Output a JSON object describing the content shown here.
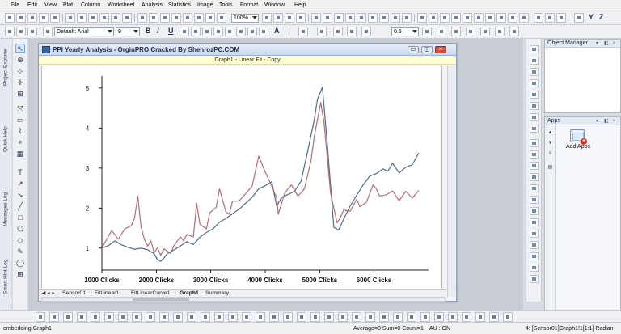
{
  "menubar": {
    "items": [
      "File",
      "Edit",
      "View",
      "Plot",
      "Column",
      "Worksheet",
      "Analysis",
      "Statistics",
      "Image",
      "Tools",
      "Format",
      "Window",
      "Help"
    ]
  },
  "toolbar": {
    "zoom": "100%",
    "font_name": "Default: Arial",
    "font_size": "9",
    "line_width": "0.5"
  },
  "left_dock": {
    "tabs": [
      "Project Explorer",
      "Quick Help",
      "Messages Log",
      "Smart Hint Log"
    ]
  },
  "graph_window": {
    "title": "PPI Yearly Analysis - OrginPRO Cracked By ShehrozPC.COM",
    "subtitle": "Graph1 - Linear Fit - Copy",
    "controls": {
      "minimize": "▭",
      "restore": "◫",
      "close": "×"
    }
  },
  "chart_data": {
    "type": "line",
    "title": "",
    "xlabel": "",
    "ylabel": "",
    "xlim": [
      0,
      100
    ],
    "ylim": [
      0.45,
      5.3
    ],
    "grid": false,
    "x_ticks": [
      {
        "label": "1000 Clicks",
        "value": 0
      },
      {
        "label": "2000 Clicks",
        "value": 16.7
      },
      {
        "label": "3000 Clicks",
        "value": 33.3
      },
      {
        "label": "4000 Clicks",
        "value": 50
      },
      {
        "label": "5000 Clicks",
        "value": 66.7
      },
      {
        "label": "6000 Clicks",
        "value": 83.3
      }
    ],
    "y_ticks": [
      1,
      2,
      3,
      4,
      5
    ],
    "series": [
      {
        "name": "",
        "color": "#4e6b8d",
        "values": [
          [
            0,
            1.0
          ],
          [
            2,
            1.06
          ],
          [
            4,
            1.18
          ],
          [
            6,
            1.08
          ],
          [
            8,
            1.02
          ],
          [
            10,
            0.97
          ],
          [
            12,
            1.0
          ],
          [
            14,
            0.96
          ],
          [
            16,
            0.86
          ],
          [
            17,
            0.72
          ],
          [
            18,
            0.67
          ],
          [
            19,
            0.75
          ],
          [
            20,
            0.86
          ],
          [
            22,
            0.95
          ],
          [
            24,
            1.05
          ],
          [
            26,
            1.16
          ],
          [
            28,
            1.09
          ],
          [
            30,
            1.27
          ],
          [
            32,
            1.39
          ],
          [
            34,
            1.48
          ],
          [
            36,
            1.65
          ],
          [
            38,
            1.74
          ],
          [
            40,
            1.86
          ],
          [
            42,
            1.97
          ],
          [
            44,
            2.12
          ],
          [
            46,
            2.27
          ],
          [
            48,
            2.48
          ],
          [
            50,
            2.56
          ],
          [
            52,
            2.66
          ],
          [
            53.5,
            2.05
          ],
          [
            55,
            2.26
          ],
          [
            57,
            2.34
          ],
          [
            59,
            2.42
          ],
          [
            61,
            2.68
          ],
          [
            63,
            3.42
          ],
          [
            65,
            4.2
          ],
          [
            66,
            4.72
          ],
          [
            67.5,
            5.02
          ],
          [
            69,
            3.6
          ],
          [
            71,
            1.52
          ],
          [
            72.5,
            1.45
          ],
          [
            74,
            1.72
          ],
          [
            76,
            2.05
          ],
          [
            78,
            2.32
          ],
          [
            80,
            2.58
          ],
          [
            82,
            2.8
          ],
          [
            84,
            2.86
          ],
          [
            86,
            2.98
          ],
          [
            87.5,
            2.92
          ],
          [
            89,
            3.12
          ],
          [
            91,
            2.88
          ],
          [
            93,
            3.02
          ],
          [
            95,
            3.08
          ],
          [
            97,
            3.38
          ]
        ]
      },
      {
        "name": "",
        "color": "#b66d73",
        "values": [
          [
            0,
            1.0
          ],
          [
            1,
            1.15
          ],
          [
            3,
            1.44
          ],
          [
            5,
            1.22
          ],
          [
            7,
            1.48
          ],
          [
            9,
            1.56
          ],
          [
            10,
            1.75
          ],
          [
            11,
            2.3
          ],
          [
            12,
            1.52
          ],
          [
            13,
            1.22
          ],
          [
            14,
            1.05
          ],
          [
            15,
            1.18
          ],
          [
            16,
            0.88
          ],
          [
            17,
            1.01
          ],
          [
            18,
            0.82
          ],
          [
            19,
            0.98
          ],
          [
            20,
            0.93
          ],
          [
            21,
            0.86
          ],
          [
            22,
            1.05
          ],
          [
            24,
            1.28
          ],
          [
            25,
            1.18
          ],
          [
            26,
            1.34
          ],
          [
            28,
            1.28
          ],
          [
            29,
            2.12
          ],
          [
            30,
            1.6
          ],
          [
            32,
            1.48
          ],
          [
            33,
            1.88
          ],
          [
            35,
            2.02
          ],
          [
            36,
            2.48
          ],
          [
            38,
            1.9
          ],
          [
            39,
            1.85
          ],
          [
            40,
            2.17
          ],
          [
            42,
            2.18
          ],
          [
            44,
            2.36
          ],
          [
            46,
            2.55
          ],
          [
            48,
            3.3
          ],
          [
            50,
            2.9
          ],
          [
            52,
            2.55
          ],
          [
            53.5,
            2.25
          ],
          [
            54,
            1.85
          ],
          [
            56,
            2.38
          ],
          [
            58,
            2.58
          ],
          [
            60,
            2.3
          ],
          [
            62,
            2.48
          ],
          [
            64,
            3.18
          ],
          [
            65,
            3.78
          ],
          [
            67,
            4.64
          ],
          [
            68,
            4.14
          ],
          [
            70,
            2.38
          ],
          [
            72,
            1.63
          ],
          [
            73,
            1.76
          ],
          [
            74,
            1.95
          ],
          [
            76,
            1.92
          ],
          [
            78,
            2.22
          ],
          [
            79,
            2.03
          ],
          [
            81,
            2.15
          ],
          [
            83,
            2.58
          ],
          [
            84,
            2.48
          ],
          [
            85,
            2.3
          ],
          [
            87,
            2.33
          ],
          [
            89,
            2.43
          ],
          [
            91,
            2.18
          ],
          [
            93,
            2.42
          ],
          [
            95,
            2.25
          ],
          [
            97,
            2.44
          ]
        ]
      }
    ]
  },
  "bottom_tabs": {
    "tabs": [
      "Sensor01",
      "FitLinear1",
      "FitLinearCurve1",
      "Graph1",
      "Summary"
    ],
    "active": "Graph1"
  },
  "apps_panel": {
    "title": "Apps",
    "add_label": "Add Apps"
  },
  "object_manager": {
    "title": "Object Manager"
  },
  "status": {
    "left": "embedding:Graph1",
    "mid": "Average=0 Sum=0 Count=1",
    "au": "AU : ON",
    "right": "4: [Sensor01]Graph1!1[1:1]  Radian"
  }
}
